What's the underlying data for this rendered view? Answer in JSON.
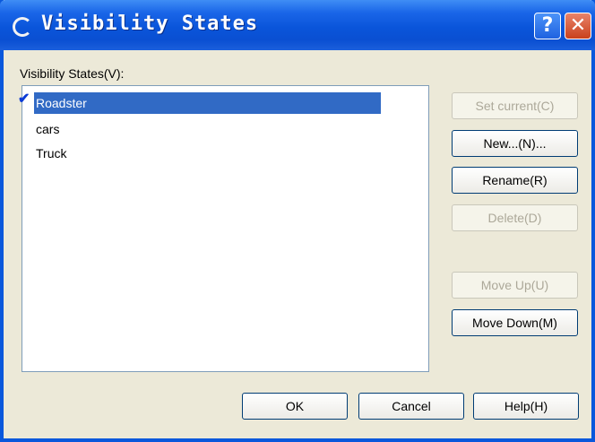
{
  "window": {
    "title": "Visibility States",
    "help_glyph": "?",
    "close_glyph": "✕"
  },
  "list": {
    "label": "Visibility States(V):",
    "items": [
      "Roadster",
      "cars",
      "Truck"
    ],
    "selected_index": 0,
    "current_mark": "✔"
  },
  "buttons": {
    "set_current": "Set current(C)",
    "new": "New...(N)...",
    "rename": "Rename(R)",
    "delete": "Delete(D)",
    "move_up": "Move Up(U)",
    "move_down": "Move Down(M)",
    "ok": "OK",
    "cancel": "Cancel",
    "help": "Help(H)"
  },
  "colors": {
    "titlebar": "#0a55da",
    "selection": "#316ac5",
    "face": "#ece9d8"
  }
}
